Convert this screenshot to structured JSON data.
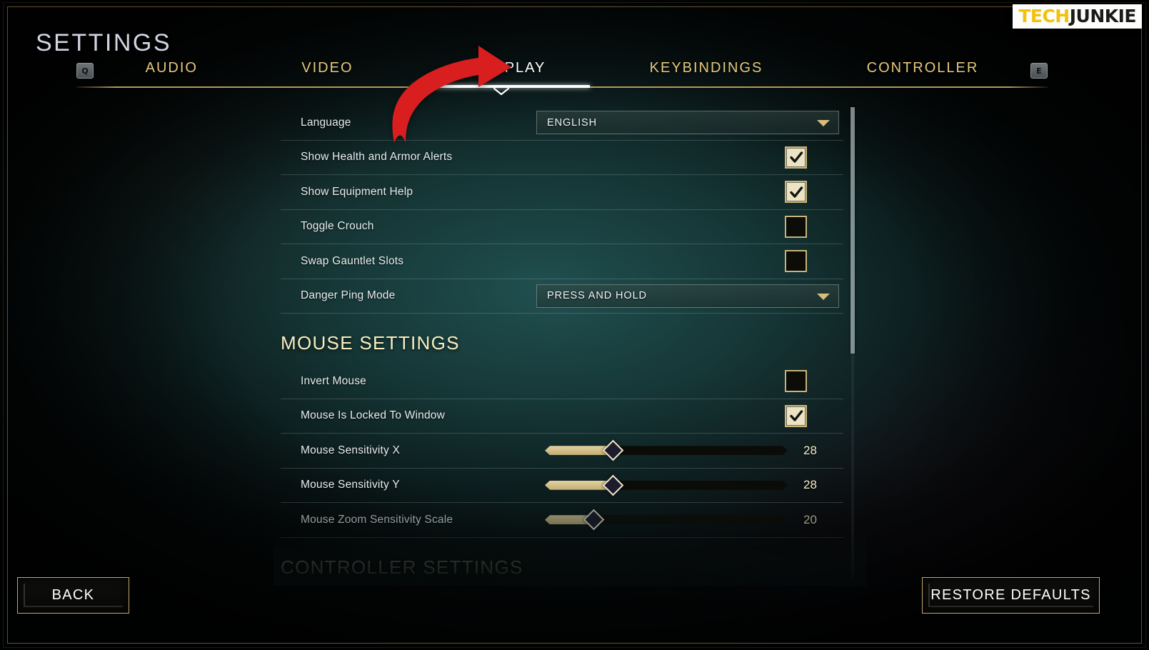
{
  "brand": {
    "part1": "TECH",
    "part2": "JUNKIE"
  },
  "header": {
    "title": "SETTINGS",
    "left_key_hint": "Q",
    "right_key_hint": "E"
  },
  "tabs": [
    {
      "label": "AUDIO",
      "active": false
    },
    {
      "label": "VIDEO",
      "active": false
    },
    {
      "label": "GAMEPLAY",
      "active": true
    },
    {
      "label": "KEYBINDINGS",
      "active": false
    },
    {
      "label": "CONTROLLER",
      "active": false
    }
  ],
  "settings": {
    "gameplay_rows": [
      {
        "type": "dropdown",
        "label": "Language",
        "value": "ENGLISH"
      },
      {
        "type": "checkbox",
        "label": "Show Health and Armor Alerts",
        "checked": true
      },
      {
        "type": "checkbox",
        "label": "Show Equipment Help",
        "checked": true
      },
      {
        "type": "checkbox",
        "label": "Toggle Crouch",
        "checked": false
      },
      {
        "type": "checkbox",
        "label": "Swap Gauntlet Slots",
        "checked": false
      },
      {
        "type": "dropdown",
        "label": "Danger Ping Mode",
        "value": "PRESS AND HOLD"
      }
    ],
    "mouse_section_title": "MOUSE SETTINGS",
    "mouse_rows": [
      {
        "type": "checkbox",
        "label": "Invert Mouse",
        "checked": false
      },
      {
        "type": "checkbox",
        "label": "Mouse Is Locked To Window",
        "checked": true
      },
      {
        "type": "slider",
        "label": "Mouse Sensitivity X",
        "value": "28",
        "percent": 28
      },
      {
        "type": "slider",
        "label": "Mouse Sensitivity Y",
        "value": "28",
        "percent": 28
      },
      {
        "type": "slider",
        "label": "Mouse Zoom Sensitivity Scale",
        "value": "20",
        "percent": 20
      }
    ],
    "controller_section_title": "CONTROLLER SETTINGS"
  },
  "footer": {
    "back_label": "BACK",
    "restore_label": "RESTORE DEFAULTS"
  },
  "colors": {
    "tab_gold": "#e6c87c",
    "tab_active": "#ffffff",
    "section_heading": "#f6eec0",
    "slider_fill": "#d8c795",
    "checkbox_border": "#c9b47a",
    "annotation_red": "#d81e1e",
    "brand_yellow": "#f4c10a"
  }
}
